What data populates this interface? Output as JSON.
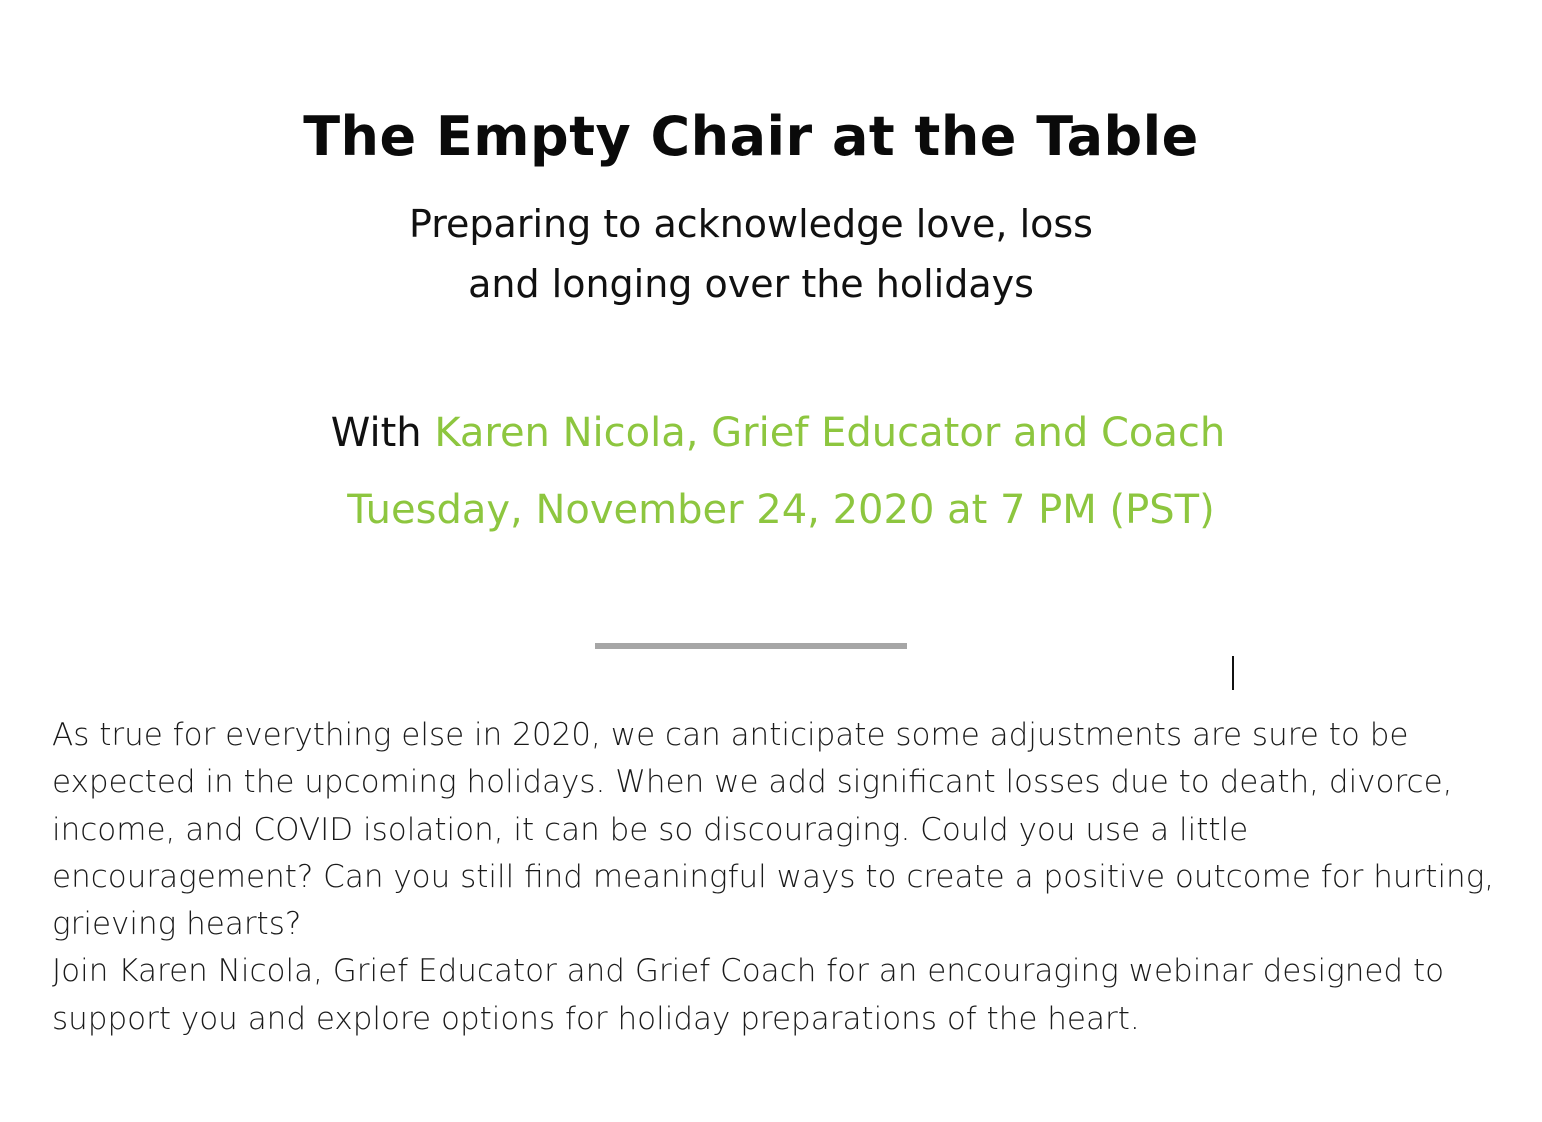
{
  "heading": {
    "title": "The Empty Chair at the Table",
    "subtitle_lines": [
      "Preparing to acknowledge love, loss",
      "and longing over the holidays"
    ]
  },
  "event": {
    "with_prefix": "With ",
    "presenter": "Karen Nicola, Grief Educator and Coach",
    "datetime": "Tuesday, November 24, 2020 at 7 PM (PST)"
  },
  "body": {
    "lines": [
      "As true for everything else in 2020, we can anticipate some adjustments are sure to be",
      "expected in the upcoming holidays.  When we add significant losses due to death, divorce,",
      "income, and COVID isolation, it can be so discouraging.  Could you use a little",
      "encouragement?  Can you still find meaningful ways to create a positive outcome for hurting,",
      "grieving hearts?",
      "Join Karen Nicola, Grief Educator and Grief Coach for an encouraging webinar designed to",
      "support you and explore options for holiday preparations of the heart."
    ]
  },
  "colors": {
    "accent": "#8dc63f",
    "divider": "#a6a6a6",
    "text": "#111111"
  }
}
